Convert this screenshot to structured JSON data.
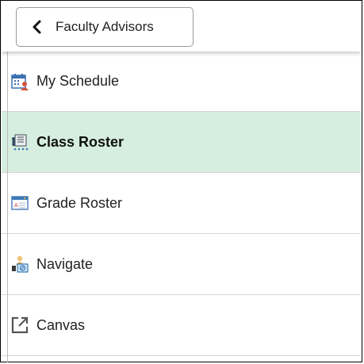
{
  "header": {
    "back_label": "Faculty Advisors",
    "back_icon": "chevron-left-icon"
  },
  "menu": {
    "items": [
      {
        "label": "My Schedule",
        "icon": "calendar-person-icon",
        "selected": false
      },
      {
        "label": "Class Roster",
        "icon": "roster-list-icon",
        "selected": true
      },
      {
        "label": "Grade Roster",
        "icon": "grade-window-icon",
        "selected": false
      },
      {
        "label": "Navigate",
        "icon": "navigate-person-icon",
        "selected": false
      },
      {
        "label": "Canvas",
        "icon": "external-link-icon",
        "selected": false
      }
    ]
  },
  "colors": {
    "selected_bg": "#d6eedf",
    "divider": "#d6d6d6"
  }
}
